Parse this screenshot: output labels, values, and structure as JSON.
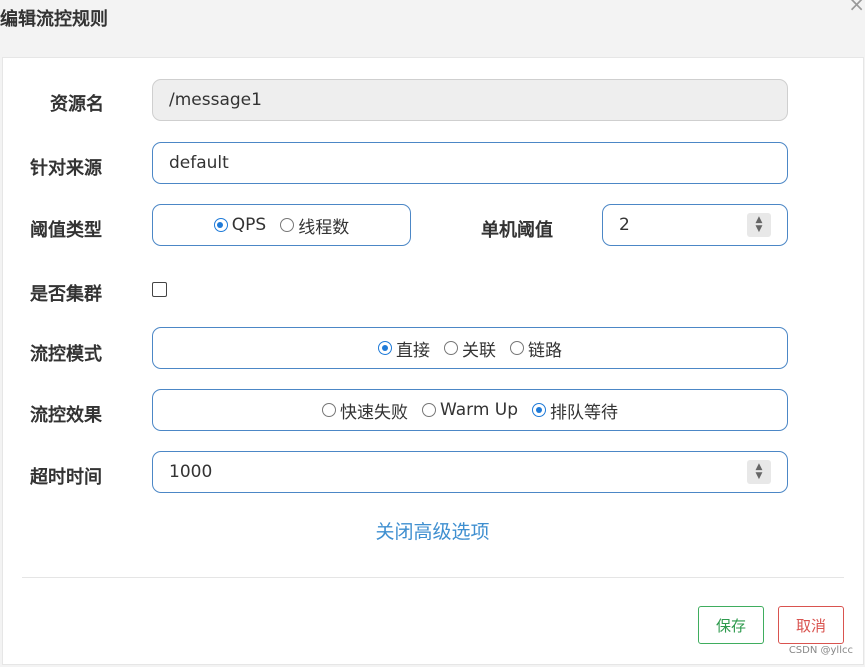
{
  "dialog": {
    "title": "编辑流控规则",
    "close": "×"
  },
  "form": {
    "resource": {
      "label": "资源名",
      "value": "/message1"
    },
    "limit_app": {
      "label": "针对来源",
      "value": "default"
    },
    "grade": {
      "label": "阈值类型",
      "options": [
        "QPS",
        "线程数"
      ],
      "selected": "QPS"
    },
    "count": {
      "label": "单机阈值",
      "value": "2"
    },
    "cluster": {
      "label": "是否集群",
      "checked": false
    },
    "strategy": {
      "label": "流控模式",
      "options": [
        "直接",
        "关联",
        "链路"
      ],
      "selected": "直接"
    },
    "control_behavior": {
      "label": "流控效果",
      "options": [
        "快速失败",
        "Warm Up",
        "排队等待"
      ],
      "selected": "排队等待"
    },
    "timeout": {
      "label": "超时时间",
      "value": "1000"
    }
  },
  "advanced_link": "关闭高级选项",
  "buttons": {
    "save": "保存",
    "cancel": "取消"
  },
  "watermark": "CSDN @yllcc",
  "colors": {
    "accent": "#1e7ad8",
    "field_border": "#4c87c6",
    "save": "#3fad5e",
    "cancel": "#d9534f",
    "link": "#3f8fd0"
  }
}
